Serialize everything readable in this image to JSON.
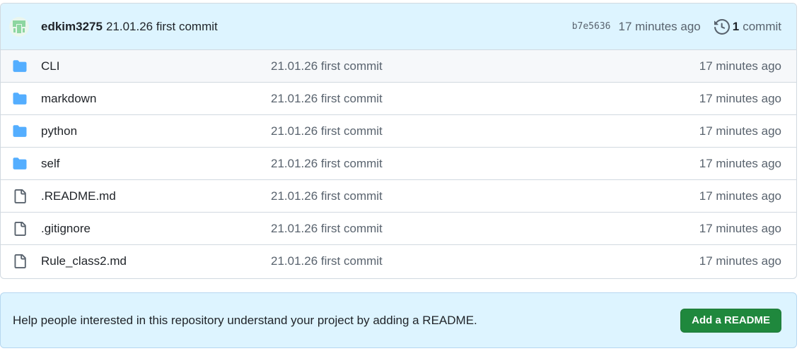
{
  "commit": {
    "author": "edkim3275",
    "message": "21.01.26 first commit",
    "sha": "b7e5636",
    "time": "17 minutes ago",
    "commit_count": "1",
    "commit_label": "commit"
  },
  "files": [
    {
      "name": "CLI",
      "type": "folder",
      "icon": "folder-icon",
      "message": "21.01.26 first commit",
      "time": "17 minutes ago"
    },
    {
      "name": "markdown",
      "type": "folder",
      "icon": "folder-icon",
      "message": "21.01.26 first commit",
      "time": "17 minutes ago"
    },
    {
      "name": "python",
      "type": "folder",
      "icon": "folder-icon",
      "message": "21.01.26 first commit",
      "time": "17 minutes ago"
    },
    {
      "name": "self",
      "type": "folder",
      "icon": "folder-icon",
      "message": "21.01.26 first commit",
      "time": "17 minutes ago"
    },
    {
      "name": ".README.md",
      "type": "file",
      "icon": "file-icon",
      "message": "21.01.26 first commit",
      "time": "17 minutes ago"
    },
    {
      "name": ".gitignore",
      "type": "file",
      "icon": "file-icon",
      "message": "21.01.26 first commit",
      "time": "17 minutes ago"
    },
    {
      "name": "Rule_class2.md",
      "type": "file",
      "icon": "file-icon",
      "message": "21.01.26 first commit",
      "time": "17 minutes ago"
    }
  ],
  "readme_banner": {
    "text": "Help people interested in this repository understand your project by adding a README.",
    "button_label": "Add a README"
  },
  "colors": {
    "folder": "#54aeff",
    "button": "#1f883d",
    "header_bg": "#ddf4ff",
    "avatar": "#8dd6a0"
  }
}
